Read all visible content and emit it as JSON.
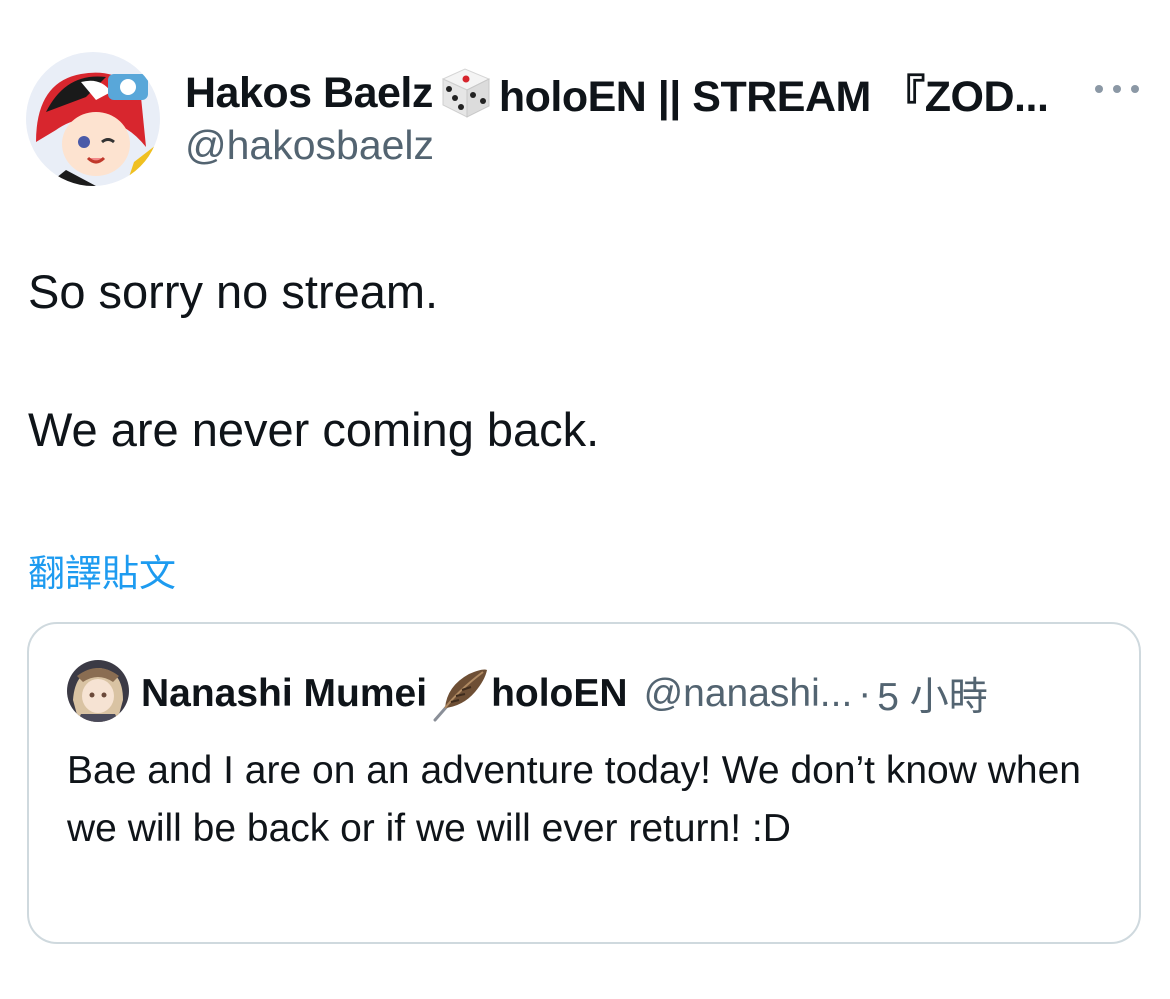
{
  "tweet": {
    "author": {
      "name_part1": "Hakos Baelz",
      "emoji_icon": "dice-icon",
      "name_part2": "holoEN || STREAM 『ZOD...",
      "handle": "@hakosbaelz"
    },
    "body_lines": [
      "So sorry no stream.",
      "We are never coming back."
    ],
    "translate_label": "翻譯貼文",
    "more_icon": "more-options-icon"
  },
  "quoted": {
    "name": "Nanashi Mumei",
    "emoji_icon": "feather-icon",
    "name_suffix": "holoEN",
    "handle": "@nanashi...",
    "separator": "·",
    "time": "5 小時",
    "text": "Bae and I are on an adventure today! We don’t know when we will be back or if we will ever return! :D"
  },
  "colors": {
    "link": "#1d9bf0",
    "secondary_text": "#536471",
    "border": "#cfd9de"
  }
}
